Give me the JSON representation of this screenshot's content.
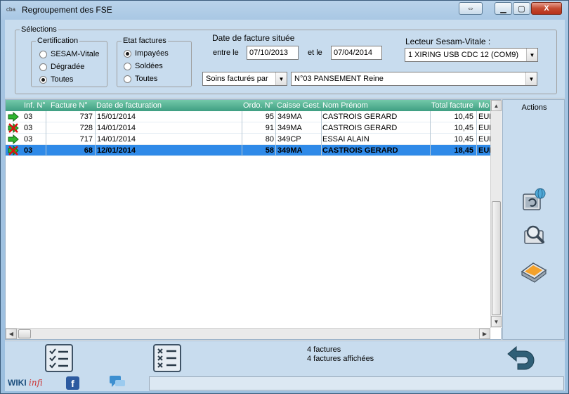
{
  "window": {
    "app_icon_text": "cba",
    "title": "Regroupement des FSE",
    "restore_glyph": "⇔",
    "min_glyph": "▁",
    "max_glyph": "▢",
    "close_glyph": "X"
  },
  "selections": {
    "group_title": "Sélections",
    "certification": {
      "title": "Certification",
      "options": [
        "SESAM-Vitale",
        "Dégradée",
        "Toutes"
      ],
      "selected": "Toutes"
    },
    "etat": {
      "title": "Etat factures",
      "options": [
        "Impayées",
        "Soldées",
        "Toutes"
      ],
      "selected": "Impayées"
    },
    "date": {
      "title": "Date de facture située",
      "between_label": "entre le",
      "from": "07/10/2013",
      "and_label": "et le",
      "to": "07/04/2014"
    },
    "reader": {
      "title": "Lecteur Sesam-Vitale :",
      "value": "1 XIRING USB CDC 12 (COM9)"
    },
    "soins_select": "Soins facturés par",
    "practitioner_select": "N°03  PANSEMENT Reine"
  },
  "grid": {
    "columns": [
      "Inf. N°",
      "Facture N°",
      "Date de facturation",
      "Ordo. N°",
      "Caisse Gest.",
      "Nom Prénom",
      "Total facture",
      "Mo"
    ],
    "rows": [
      {
        "status": "paid",
        "inf": "03",
        "facture": "737",
        "date": "15/01/2014",
        "ordo": "95",
        "caisse": "349MA",
        "nom": "CASTROIS GERARD",
        "total": "10,45",
        "mo": "EUR"
      },
      {
        "status": "unpaid",
        "inf": "03",
        "facture": "728",
        "date": "14/01/2014",
        "ordo": "91",
        "caisse": "349MA",
        "nom": "CASTROIS GERARD",
        "total": "10,45",
        "mo": "EUR"
      },
      {
        "status": "paid",
        "inf": "03",
        "facture": "717",
        "date": "14/01/2014",
        "ordo": "80",
        "caisse": "349CP",
        "nom": "ESSAI ALAIN",
        "total": "10,45",
        "mo": "EUR"
      },
      {
        "status": "unpaid",
        "inf": "03",
        "facture": "68",
        "date": "12/01/2014",
        "ordo": "58",
        "caisse": "349MA",
        "nom": "CASTROIS GERARD",
        "total": "18,45",
        "mo": "EUR",
        "selected": true
      }
    ]
  },
  "actions": {
    "title": "Actions"
  },
  "footer": {
    "count": "4 factures",
    "shown": "4 factures affichées",
    "wiki": "WIKI",
    "wiki_suffix": "infi",
    "fb_letter": "f"
  },
  "colors": {
    "header_green": "#3f9e82",
    "selected_row": "#2f8ae8",
    "panel": "#c8dcee"
  }
}
